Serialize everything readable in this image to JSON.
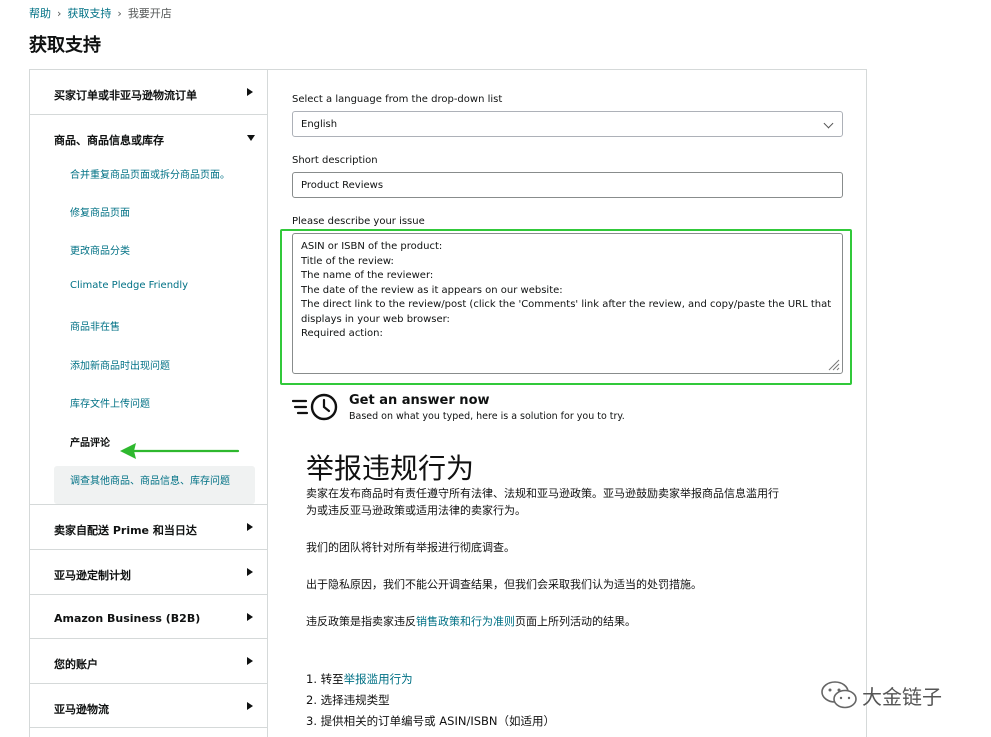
{
  "breadcrumb": {
    "items": [
      "帮助",
      "获取支持",
      "我要开店"
    ],
    "separator": "›"
  },
  "page_title": "获取支持",
  "sidebar": {
    "sections": [
      {
        "label": "买家订单或非亚马逊物流订单",
        "expanded": false
      },
      {
        "label": "商品、商品信息或库存",
        "expanded": true,
        "items": [
          "合并重复商品页面或拆分商品页面。",
          "修复商品页面",
          "更改商品分类",
          "Climate Pledge Friendly",
          "商品非在售",
          "添加新商品时出现问题",
          "库存文件上传问题",
          "产品评论",
          "调查其他商品、商品信息、库存问题"
        ],
        "active_item": "产品评论"
      },
      {
        "label": "卖家自配送 Prime 和当日达",
        "expanded": false
      },
      {
        "label": "亚马逊定制计划",
        "expanded": false
      },
      {
        "label": "Amazon Business (B2B)",
        "expanded": false
      },
      {
        "label": "您的账户",
        "expanded": false
      },
      {
        "label": "亚马逊物流",
        "expanded": false
      }
    ]
  },
  "form": {
    "language_label": "Select a language from the drop-down list",
    "language_value": "English",
    "short_desc_label": "Short description",
    "short_desc_value": "Product Reviews",
    "describe_label": "Please describe your issue",
    "describe_lines": [
      "ASIN or ISBN of the product:",
      "Title of the review:",
      "The name of the reviewer:",
      "The date of the review as it appears on our website:",
      "The direct link to the review/post (click the 'Comments' link after the review, and copy/paste the URL that",
      "displays in your web browser:",
      "Required action:"
    ]
  },
  "answer": {
    "title": "Get an answer now",
    "subtitle": "Based on what you typed, here is a solution for you to try."
  },
  "article": {
    "title": "举报违规行为",
    "p1_line1": "卖家在发布商品时有责任遵守所有法律、法规和亚马逊政策。亚马逊鼓励卖家举报商品信息滥用行",
    "p1_line2": "为或违反亚马逊政策或适用法律的卖家行为。",
    "p2": "我们的团队将针对所有举报进行彻底调查。",
    "p3": "出于隐私原因，我们不能公开调查结果，但我们会采取我们认为适当的处罚措施。",
    "p4_pre": "违反政策是指卖家违反",
    "p4_link": "销售政策和行为准则",
    "p4_post": "页面上所列活动的结果。",
    "steps": [
      {
        "prefix": "1. 转至",
        "link": "举报滥用行为"
      },
      {
        "prefix": "2. 选择违规类型",
        "link": ""
      },
      {
        "prefix": "3. 提供相关的订单编号或 ASIN/ISBN（如适用）",
        "link": ""
      }
    ]
  },
  "watermark": {
    "text": "大金链子"
  },
  "colors": {
    "link": "#007185",
    "highlight": "#31c93a",
    "arrow": "#2eb82e",
    "border": "#d5d9d9"
  },
  "icons": [
    "chevron-down-icon",
    "caret-right-icon",
    "caret-down-icon",
    "clock-icon",
    "resize-grip-icon",
    "wechat-icon",
    "arrow-left-icon"
  ]
}
